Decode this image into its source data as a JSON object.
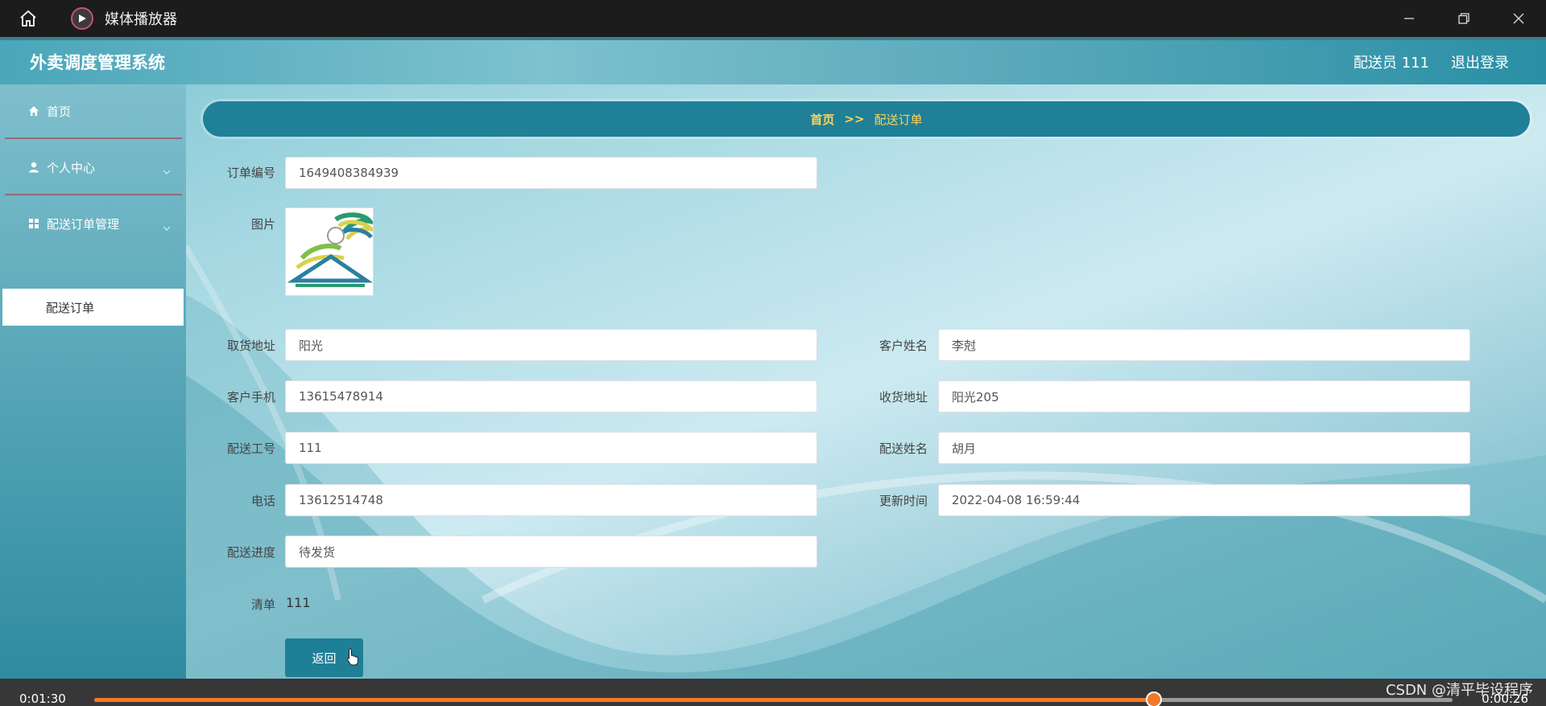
{
  "player": {
    "title": "媒体播放器",
    "time_elapsed": "0:01:30",
    "time_remaining": "0:00:26",
    "progress": 0.78,
    "watermark": "CSDN @清平毕设程序",
    "accent_color": "#f07a2a"
  },
  "app": {
    "title": "外卖调度管理系统",
    "user_label": "配送员 111",
    "logout_label": "退出登录"
  },
  "sidebar": {
    "items": [
      {
        "label": "首页",
        "icon": "home-icon"
      },
      {
        "label": "个人中心",
        "icon": "user-icon"
      },
      {
        "label": "配送订单管理",
        "icon": "grid-icon"
      }
    ],
    "sub_items": [
      {
        "label": "配送订单"
      }
    ]
  },
  "breadcrumb": {
    "home": "首页",
    "separator": ">>",
    "current": "配送订单"
  },
  "form": {
    "order_no": {
      "label": "订单编号",
      "value": "1649408384939"
    },
    "image": {
      "label": "图片"
    },
    "pickup_address": {
      "label": "取货地址",
      "value": "阳光"
    },
    "customer_name": {
      "label": "客户姓名",
      "value": "李尅"
    },
    "customer_phone": {
      "label": "客户手机",
      "value": "13615478914"
    },
    "delivery_address": {
      "label": "收货地址",
      "value": "阳光205"
    },
    "courier_id": {
      "label": "配送工号",
      "value": "111"
    },
    "courier_name": {
      "label": "配送姓名",
      "value": "胡月"
    },
    "phone": {
      "label": "电话",
      "value": "13612514748"
    },
    "updated_at": {
      "label": "更新时间",
      "value": "2022-04-08 16:59:44"
    },
    "progress": {
      "label": "配送进度",
      "value": "待发货"
    },
    "list": {
      "label": "清单",
      "value": "111"
    },
    "back_label": "返回"
  }
}
